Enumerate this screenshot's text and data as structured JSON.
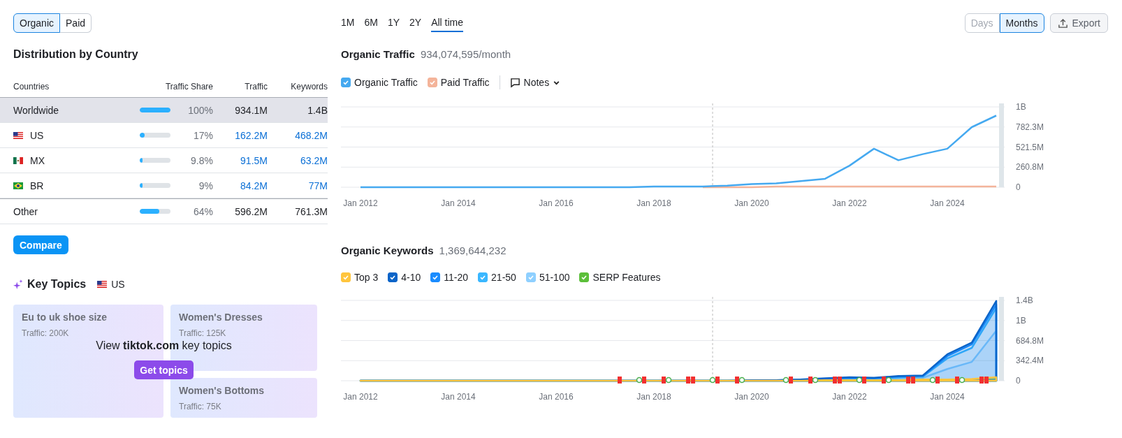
{
  "source_tabs": [
    {
      "label": "Organic",
      "selected": true
    },
    {
      "label": "Paid",
      "selected": false
    }
  ],
  "distribution": {
    "title": "Distribution by Country",
    "columns": [
      "Countries",
      "Traffic Share",
      "Traffic",
      "Keywords"
    ],
    "rows": [
      {
        "kind": "worldwide",
        "country": "Worldwide",
        "level": 1,
        "share": "100%",
        "traffic": "934.1M",
        "keywords": "1.4B",
        "selected": true
      },
      {
        "kind": "us",
        "country": "US",
        "level": 0.17,
        "share": "17%",
        "traffic": "162.2M",
        "keywords": "468.2M",
        "selected": false
      },
      {
        "kind": "mx",
        "country": "MX",
        "level": 0.098,
        "share": "9.8%",
        "traffic": "91.5M",
        "keywords": "63.2M",
        "selected": false
      },
      {
        "kind": "br",
        "country": "BR",
        "level": 0.09,
        "share": "9%",
        "traffic": "84.2M",
        "keywords": "77M",
        "selected": false
      },
      {
        "kind": "other",
        "country": "Other",
        "level": 0.64,
        "share": "64%",
        "traffic": "596.2M",
        "keywords": "761.3M",
        "selected": false
      }
    ],
    "compare_button": "Compare"
  },
  "key_topics": {
    "title": "Key Topics",
    "kind": "us",
    "country": "US",
    "cards": [
      {
        "title": "Eu to uk shoe size",
        "traffic": "Traffic: 200K"
      },
      {
        "title": "Women's Dresses",
        "traffic": "Traffic: 125K"
      },
      {
        "title": "Women's Bottoms",
        "traffic": "Traffic: 75K"
      }
    ],
    "overlay_text": "View **tiktok.com** key topics",
    "button": "Get topics"
  },
  "periods": [
    {
      "label": "1M",
      "selected": false
    },
    {
      "label": "6M",
      "selected": false
    },
    {
      "label": "1Y",
      "selected": false
    },
    {
      "label": "2Y",
      "selected": false
    },
    {
      "label": "All time",
      "selected": true
    }
  ],
  "granularity": [
    {
      "label": "Days",
      "selected": false
    },
    {
      "label": "Months",
      "selected": true
    }
  ],
  "export_button": "Export",
  "traffic_chart": {
    "title": "Organic Traffic",
    "value": "934,074,595/month",
    "legend": [
      {
        "checked": true
      },
      {
        "checked": true
      }
    ],
    "notes_button": "Notes",
    "chart_data": {
      "type": "line",
      "categories": [
        "Jan 2012",
        null,
        null,
        null,
        "Jan 2014",
        null,
        null,
        null,
        "Jan 2016",
        null,
        null,
        null,
        "Jan 2018",
        null,
        null,
        null,
        "Jan 2020",
        null,
        null,
        null,
        "Jan 2022",
        null,
        null,
        null,
        "Jan 2024",
        null,
        null
      ],
      "series": [
        {
          "name": "Organic Traffic",
          "color": "#45a9f0",
          "values": [
            0,
            0,
            0,
            0,
            0,
            0,
            0,
            0,
            0,
            0,
            0,
            0,
            10000000,
            10000000,
            10000000,
            20000000,
            40000000,
            50000000,
            80000000,
            110000000,
            280000000,
            500000000,
            350000000,
            430000000,
            500000000,
            780000000,
            930000000
          ]
        },
        {
          "name": "Paid Traffic",
          "color": "#f4b49a",
          "values": [
            null,
            null,
            null,
            null,
            null,
            null,
            null,
            null,
            null,
            null,
            null,
            null,
            null,
            null,
            0,
            0,
            0,
            10000000,
            10000000,
            10000000,
            10000000,
            10000000,
            10000000,
            10000000,
            10000000,
            10000000,
            10000000
          ]
        }
      ],
      "grid": true,
      "yticks": [
        {
          "value": 0,
          "label": "0"
        },
        {
          "value": 260800000,
          "label": "260.8M"
        },
        {
          "value": 521500000,
          "label": "521.5M"
        },
        {
          "value": 782300000,
          "label": "782.3M"
        },
        {
          "value": 1043200000,
          "label": "1B"
        }
      ],
      "ylim": [
        0,
        1043200000
      ]
    }
  },
  "keywords_chart": {
    "title": "Organic Keywords",
    "value": "1,369,644,232",
    "legend": [
      {
        "checked": true
      },
      {
        "checked": true
      },
      {
        "checked": true
      },
      {
        "checked": true
      },
      {
        "checked": true
      },
      {
        "checked": true
      }
    ],
    "chart_data": {
      "type": "area",
      "categories": [
        "Jan 2012",
        null,
        null,
        null,
        "Jan 2014",
        null,
        null,
        null,
        "Jan 2016",
        null,
        null,
        null,
        "Jan 2018",
        null,
        null,
        null,
        "Jan 2020",
        null,
        null,
        null,
        "Jan 2022",
        null,
        null,
        null,
        "Jan 2024",
        null,
        null
      ],
      "series": [
        {
          "name": "Top 3",
          "color": "#ffc53d",
          "values": [
            0,
            0,
            0,
            0,
            0,
            0,
            0,
            0,
            0,
            0,
            0,
            0,
            0,
            0,
            0,
            0,
            0,
            0,
            0,
            10000000,
            10000000,
            10000000,
            10000000,
            20000000,
            20000000,
            30000000,
            60000000
          ]
        },
        {
          "name": "4-10",
          "color": "#0b64c8",
          "values": [
            0,
            0,
            0,
            0,
            0,
            0,
            0,
            0,
            0,
            0,
            0,
            0,
            0,
            0,
            0,
            0,
            10000000,
            10000000,
            20000000,
            40000000,
            60000000,
            50000000,
            80000000,
            90000000,
            450000000,
            650000000,
            1360000000
          ]
        },
        {
          "name": "11-20",
          "color": "#1a8cff",
          "values": [
            0,
            0,
            0,
            0,
            0,
            0,
            0,
            0,
            0,
            0,
            0,
            0,
            0,
            0,
            0,
            0,
            0,
            10000000,
            20000000,
            30000000,
            50000000,
            40000000,
            70000000,
            80000000,
            420000000,
            620000000,
            1300000000
          ]
        },
        {
          "name": "21-50",
          "color": "#3ab7ff",
          "values": [
            0,
            0,
            0,
            0,
            0,
            0,
            0,
            0,
            0,
            0,
            0,
            0,
            0,
            0,
            0,
            0,
            0,
            0,
            10000000,
            20000000,
            40000000,
            40000000,
            60000000,
            70000000,
            380000000,
            560000000,
            1240000000
          ]
        },
        {
          "name": "51-100",
          "color": "#8fd0ff",
          "values": [
            0,
            0,
            0,
            0,
            0,
            0,
            0,
            0,
            0,
            0,
            0,
            0,
            0,
            0,
            0,
            0,
            0,
            0,
            10000000,
            20000000,
            30000000,
            20000000,
            40000000,
            50000000,
            200000000,
            320000000,
            850000000
          ]
        },
        {
          "name": "SERP Features",
          "color": "#5cbf3a",
          "values": [
            0,
            0,
            0,
            0,
            0,
            0,
            0,
            0,
            0,
            0,
            0,
            0,
            0,
            0,
            0,
            0,
            0,
            0,
            0,
            0,
            0,
            0,
            0,
            0,
            0,
            0,
            30000000
          ]
        }
      ],
      "grid": true,
      "yticks": [
        {
          "value": 0,
          "label": "0"
        },
        {
          "value": 342400000,
          "label": "342.4M"
        },
        {
          "value": 684800000,
          "label": "684.8M"
        },
        {
          "value": 1027200000,
          "label": "1B"
        },
        {
          "value": 1369600000,
          "label": "1.4B"
        }
      ],
      "ylim": [
        0,
        1369600000
      ]
    }
  }
}
